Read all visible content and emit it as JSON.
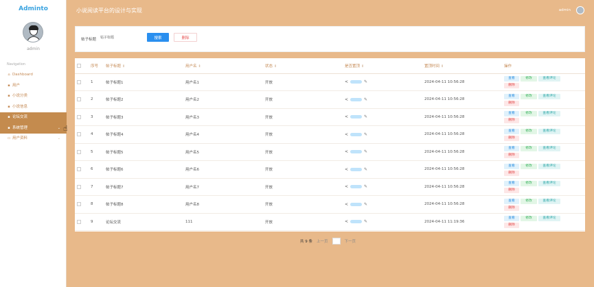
{
  "app": {
    "logo": "Adminto",
    "title": "小说阅读平台的设计与实现",
    "user": "admin"
  },
  "sidebar": {
    "avatar_name": "admin",
    "nav_caption": "Navigation",
    "items": [
      {
        "label": "Dashboard",
        "icon": "home-icon",
        "glyph": "⌂"
      },
      {
        "label": "用户",
        "icon": "grid-icon",
        "glyph": "▪"
      },
      {
        "label": "小说分类",
        "icon": "grid-icon",
        "glyph": "▪"
      },
      {
        "label": "小说信息",
        "icon": "grid-icon",
        "glyph": "▪"
      },
      {
        "label": "论坛交流",
        "icon": "grid-icon",
        "glyph": "▪"
      },
      {
        "label": "系统管理",
        "icon": "grid-icon",
        "glyph": "▪",
        "caret": "⌄"
      },
      {
        "label": "用户资料",
        "icon": "profile-icon",
        "glyph": "▭",
        "caret": "⌄"
      }
    ]
  },
  "search": {
    "label": "帖子标题",
    "placeholder": "帖子标题",
    "search_btn": "搜索",
    "delete_btn": "删除"
  },
  "table": {
    "headers": [
      "序号",
      "帖子标题",
      "用户名",
      "状态",
      "是否置顶",
      "置顶时间",
      "操作"
    ],
    "ops": {
      "view": "查看",
      "edit": "修改",
      "comment": "查看评论",
      "delete": "删除"
    },
    "rows": [
      {
        "no": "1",
        "title": "帖子标题1",
        "user": "用户名1",
        "status": "开放",
        "time": "2024-04-11 10:56:28"
      },
      {
        "no": "2",
        "title": "帖子标题2",
        "user": "用户名2",
        "status": "开放",
        "time": "2024-04-11 10:56:28"
      },
      {
        "no": "3",
        "title": "帖子标题3",
        "user": "用户名3",
        "status": "开放",
        "time": "2024-04-11 10:56:28"
      },
      {
        "no": "4",
        "title": "帖子标题4",
        "user": "用户名4",
        "status": "开放",
        "time": "2024-04-11 10:56:28"
      },
      {
        "no": "5",
        "title": "帖子标题5",
        "user": "用户名5",
        "status": "开放",
        "time": "2024-04-11 10:56:28"
      },
      {
        "no": "6",
        "title": "帖子标题6",
        "user": "用户名6",
        "status": "开放",
        "time": "2024-04-11 10:56:28"
      },
      {
        "no": "7",
        "title": "帖子标题7",
        "user": "用户名7",
        "status": "开放",
        "time": "2024-04-11 10:56:28"
      },
      {
        "no": "8",
        "title": "帖子标题8",
        "user": "用户名8",
        "status": "开放",
        "time": "2024-04-11 10:56:28"
      },
      {
        "no": "9",
        "title": "论坛交流",
        "user": "111",
        "status": "开放",
        "time": "2024-04-11 11:19:36"
      }
    ]
  },
  "pagination": {
    "total": "共 9 条",
    "prev": "上一页",
    "next": "下一页"
  },
  "colors": {
    "accent": "#c48b4e",
    "background": "#e8b98a",
    "primary": "#2a8fef",
    "danger": "#e85a5a"
  }
}
